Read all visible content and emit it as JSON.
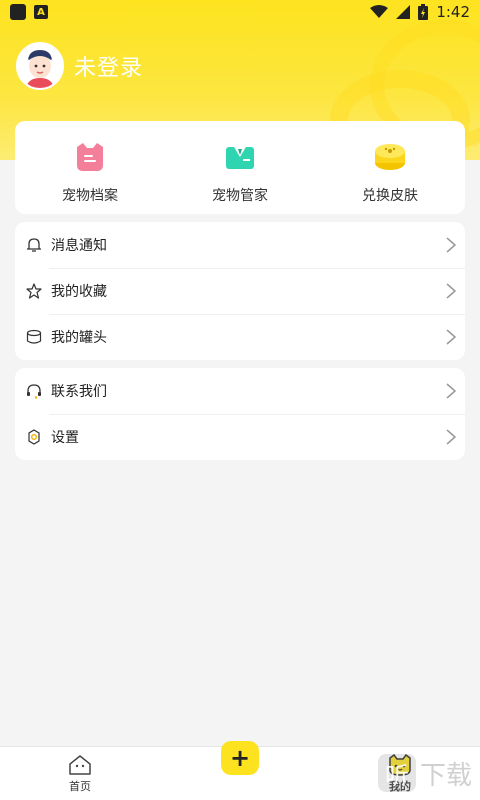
{
  "status_bar": {
    "time": "1:42",
    "notif_letter": "A"
  },
  "profile": {
    "login_text": "未登录"
  },
  "quick_actions": [
    {
      "label": "宠物档案",
      "icon": "pet-file-icon"
    },
    {
      "label": "宠物管家",
      "icon": "pet-butler-icon"
    },
    {
      "label": "兑换皮肤",
      "icon": "skin-exchange-icon"
    }
  ],
  "menu_group1": [
    {
      "label": "消息通知",
      "icon": "bell-icon"
    },
    {
      "label": "我的收藏",
      "icon": "star-icon"
    },
    {
      "label": "我的罐头",
      "icon": "can-icon"
    }
  ],
  "menu_group2": [
    {
      "label": "联系我们",
      "icon": "headset-icon"
    },
    {
      "label": "设置",
      "icon": "settings-icon"
    }
  ],
  "tabbar": {
    "home": "首页",
    "plus": "+",
    "mine": "我的"
  },
  "watermark": {
    "logo": "听",
    "text": "下载"
  },
  "colors": {
    "accent": "#fde31f",
    "background": "#f4f4f4"
  }
}
